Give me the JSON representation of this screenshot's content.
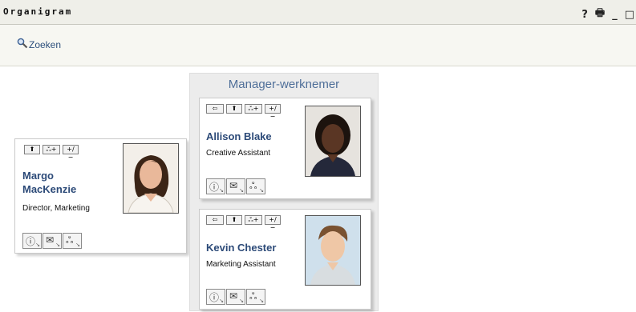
{
  "window": {
    "title": "Organigram",
    "controls": [
      "?",
      "🖶",
      "_",
      "□"
    ]
  },
  "toolbar": {
    "search_label": "Zoeken"
  },
  "group": {
    "title": "Manager-werknemer"
  },
  "small_buttons": {
    "up": "⬆",
    "add": "+/−",
    "team": "ஃ+",
    "back": "⇦"
  },
  "manager": {
    "name_line1": "Margo",
    "name_line2": "MacKenzie",
    "title": "Director, Marketing"
  },
  "employees": [
    {
      "name": "Allison Blake",
      "title": "Creative Assistant"
    },
    {
      "name": "Kevin Chester",
      "title": "Marketing Assistant"
    }
  ],
  "action_icons": [
    "info-icon",
    "email-icon",
    "org-chart-icon"
  ],
  "colors": {
    "name": "#2c4a78",
    "group_title": "#4f6f99",
    "link": "#2c4f7c"
  }
}
